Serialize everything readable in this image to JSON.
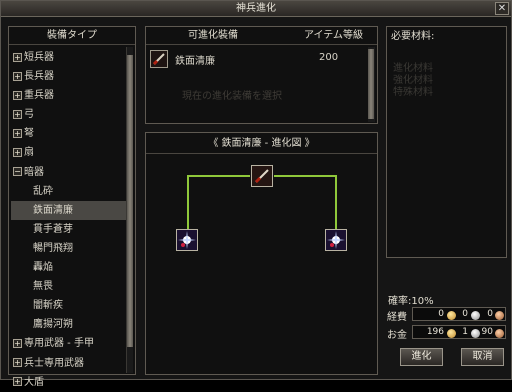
{
  "window": {
    "title": "神兵進化",
    "close_glyph": "✕"
  },
  "category_panel": {
    "header": "裝備タイプ",
    "items": [
      {
        "label": "短兵器",
        "toggle": "+",
        "level": "top"
      },
      {
        "label": "長兵器",
        "toggle": "+",
        "level": "top"
      },
      {
        "label": "重兵器",
        "toggle": "+",
        "level": "top"
      },
      {
        "label": "弓",
        "toggle": "+",
        "level": "top"
      },
      {
        "label": "弩",
        "toggle": "+",
        "level": "top"
      },
      {
        "label": "扇",
        "toggle": "+",
        "level": "top"
      },
      {
        "label": "暗器",
        "toggle": "−",
        "level": "top"
      },
      {
        "label": "乱砕",
        "toggle": "",
        "level": "sub"
      },
      {
        "label": "鉄面清廉",
        "toggle": "",
        "level": "sub",
        "selected": true
      },
      {
        "label": "貫手蒼芽",
        "toggle": "",
        "level": "sub"
      },
      {
        "label": "暢門飛翔",
        "toggle": "",
        "level": "sub"
      },
      {
        "label": "轟焔",
        "toggle": "",
        "level": "sub"
      },
      {
        "label": "無畏",
        "toggle": "",
        "level": "sub"
      },
      {
        "label": "闇斬疾",
        "toggle": "",
        "level": "sub"
      },
      {
        "label": "鷹揚河朔",
        "toggle": "",
        "level": "sub"
      },
      {
        "label": "専用武器 - 手甲",
        "toggle": "+",
        "level": "top"
      },
      {
        "label": "兵士専用武器",
        "toggle": "+",
        "level": "top"
      },
      {
        "label": "大盾",
        "toggle": "+",
        "level": "top"
      }
    ]
  },
  "evolvable_panel": {
    "col_equipment": "可進化裝備",
    "col_grade": "アイテム等級",
    "rows": [
      {
        "name": "鉄面清廉",
        "grade": "200",
        "icon": "dagger-item-icon"
      }
    ],
    "faint_hint": "現在の進化装備を選択"
  },
  "tree_panel": {
    "title": "《 鉄面清廉 - 進化図 》",
    "root_icon": "dagger-item-icon",
    "child_icons": [
      "star-burst-icon",
      "star-burst-icon"
    ],
    "connector_color": "#8fc83a"
  },
  "materials_panel": {
    "header": "必要材料:",
    "faint_lines": [
      "進化材料",
      "強化材料",
      "特殊材料"
    ]
  },
  "rate": {
    "label": "確率:",
    "value": "10%"
  },
  "money": {
    "fee": {
      "label": "経費",
      "gold": "0",
      "silver": "0",
      "copper": "0"
    },
    "owned": {
      "label": "お金",
      "gold": "196",
      "silver": "1",
      "copper": "90"
    }
  },
  "buttons": {
    "evolve": "進化",
    "cancel": "取消"
  },
  "colors": {
    "accent_green": "#8fc83a",
    "selected_row": "#4a4844"
  }
}
